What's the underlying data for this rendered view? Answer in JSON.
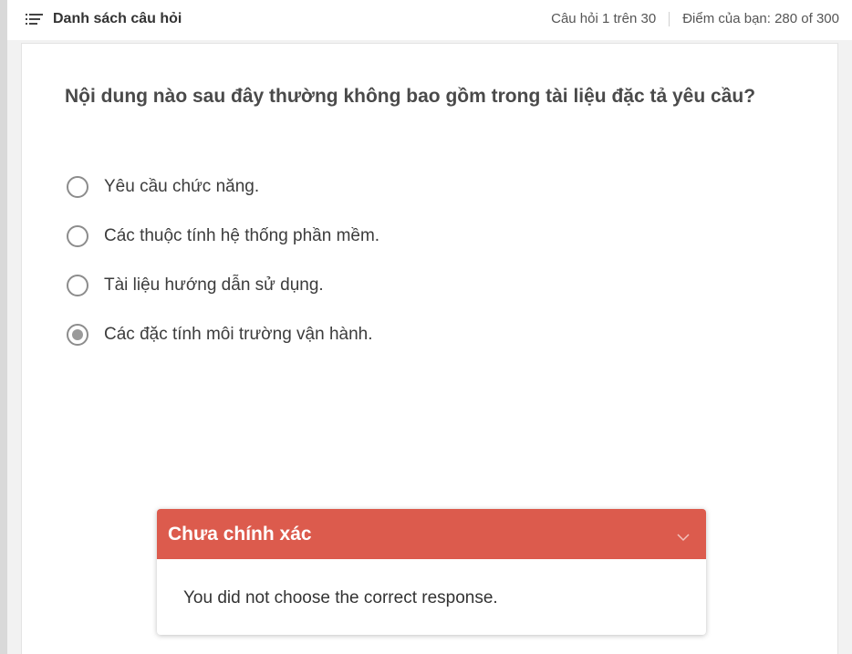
{
  "header": {
    "question_list_label": "Danh sách câu hỏi",
    "question_counter": "Câu hỏi 1 trên 30",
    "score": "Điểm của bạn: 280 of 300"
  },
  "question": {
    "text": "Nội dung nào sau đây thường không bao gồm trong tài liệu đặc tả yêu cầu?",
    "options": [
      {
        "label": "Yêu cầu chức năng.",
        "selected": false
      },
      {
        "label": "Các thuộc tính hệ thống phần mềm.",
        "selected": false
      },
      {
        "label": "Tài liệu hướng dẫn sử dụng.",
        "selected": false
      },
      {
        "label": "Các đặc tính môi trường vận hành.",
        "selected": true
      }
    ]
  },
  "feedback": {
    "title": "Chưa chính xác",
    "message": "You did not choose the correct response.",
    "color": "#dc5b4d"
  },
  "icons": {
    "question_list": "list-icon",
    "collapse": "chevron-down-icon"
  }
}
